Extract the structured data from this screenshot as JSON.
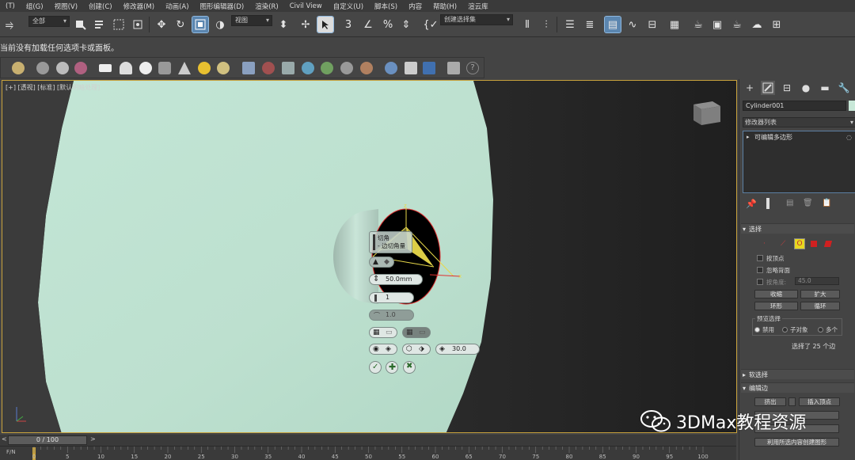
{
  "menu": [
    "(T)",
    "组(G)",
    "视图(V)",
    "创建(C)",
    "修改器(M)",
    "动画(A)",
    "图形编辑器(D)",
    "渲染(R)",
    "Civil View",
    "自定义(U)",
    "脚本(S)",
    "内容",
    "帮助(H)",
    "渲云库"
  ],
  "toolbar": {
    "selection_filter": "全部",
    "reference_coord": "视图",
    "named_selection_set": "创建选择集"
  },
  "status_message": "当前没有加载任何选项卡或面板。",
  "viewport": {
    "label": "[+] [透视] [标准] [默认明暗处理]",
    "object_color": "#bfe3d2"
  },
  "caddy": {
    "title_line1": "切角",
    "title_line2": "- 边切角量",
    "amount": "50.0mm",
    "segments": "1",
    "tension": "1.0",
    "smooth_threshold": "30.0"
  },
  "timeline": {
    "frame_display": "0 / 100",
    "fn_label": "F/N",
    "ticks": [
      "0",
      "5",
      "10",
      "15",
      "20",
      "25",
      "30",
      "35",
      "40",
      "45",
      "50",
      "55",
      "60",
      "65",
      "70",
      "75",
      "80",
      "85",
      "90",
      "95",
      "100"
    ]
  },
  "command_panel": {
    "object_name": "Cylinder001",
    "modifier_list": "修改器列表",
    "stack_item": "可编辑多边形",
    "selection_rollout": "选择",
    "by_vertex": "按顶点",
    "ignore_backfacing": "忽略背面",
    "by_angle_label": "按角度:",
    "by_angle_value": "45.0",
    "shrink": "收缩",
    "grow": "扩大",
    "ring": "环形",
    "loop": "循环",
    "preview_selection": "预览选择",
    "preview_off": "禁用",
    "preview_subobject": "子对象",
    "preview_multi": "多个",
    "selection_info": "选择了 25 个边",
    "soft_selection": "软选择",
    "edit_edges": "编辑边",
    "extrude": "挤出",
    "insert_vertex": "插入顶点",
    "create_shape": "利用所选内容创建图形"
  },
  "watermark": "3DMax教程资源",
  "colors": {
    "accent_blue": "#5b86b0",
    "viewport_border": "#c8a23c",
    "gizmo_red": "#e03030",
    "gizmo_yellow": "#e8d84a"
  }
}
